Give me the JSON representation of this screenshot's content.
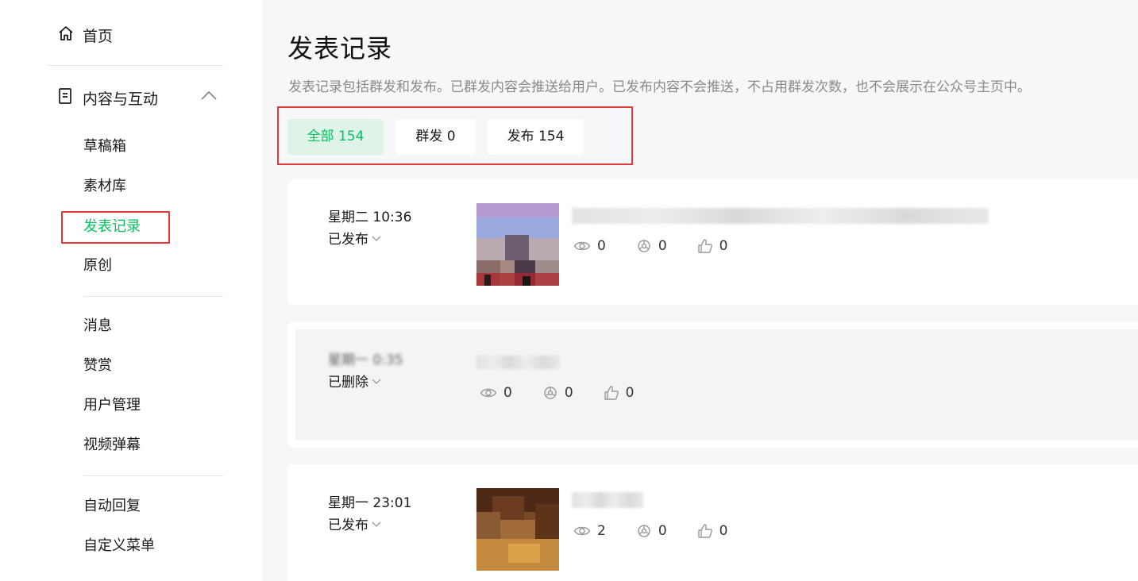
{
  "sidebar": {
    "home_label": "首页",
    "group_label": "内容与互动",
    "sub_items": [
      "草稿箱",
      "素材库",
      "发表记录",
      "原创"
    ],
    "items2": [
      "消息",
      "赞赏",
      "用户管理",
      "视频弹幕"
    ],
    "items3": [
      "自动回复",
      "自定义菜单"
    ]
  },
  "page": {
    "title": "发表记录",
    "description": "发表记录包括群发和发布。已群发内容会推送给用户。已发布内容不会推送，不占用群发次数，也不会展示在公众号主页中。"
  },
  "tabs": [
    {
      "label": "全部 154",
      "selected": true
    },
    {
      "label": "群发 0",
      "selected": false
    },
    {
      "label": "发布 154",
      "selected": false
    }
  ],
  "records": [
    {
      "time": "星期二 10:36",
      "status": "已发布",
      "views": "0",
      "shares": "0",
      "likes": "0"
    },
    {
      "time": "星期一 0:35",
      "status": "已删除",
      "views": "0",
      "shares": "0",
      "likes": "0"
    },
    {
      "time": "星期一 23:01",
      "status": "已发布",
      "views": "2",
      "shares": "0",
      "likes": "0"
    }
  ],
  "colors": {
    "accent": "#07c160",
    "accent_bg": "#dff3e8",
    "highlight_border": "#e5383b",
    "main_bg": "#f6f7f9"
  },
  "icons": [
    "home-icon",
    "document-icon",
    "chevron-up-icon",
    "chevron-down-icon",
    "eye-icon",
    "share-icon",
    "thumb-up-icon"
  ]
}
